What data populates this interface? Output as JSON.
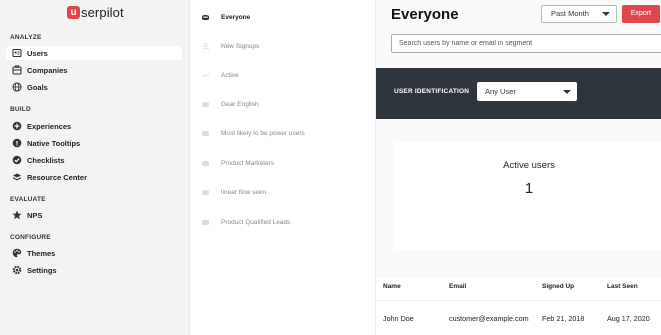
{
  "brand": {
    "logo_letter": "u",
    "logo_text": "serpilot",
    "accent": "#e0474c"
  },
  "sidebar": {
    "sections": {
      "analyze": "ANALYZE",
      "build": "BUILD",
      "evaluate": "EVALUATE",
      "configure": "CONFIGURE"
    },
    "items": [
      {
        "label": "Users",
        "icon": "users-icon"
      },
      {
        "label": "Companies",
        "icon": "companies-icon"
      },
      {
        "label": "Goals",
        "icon": "goals-icon"
      },
      {
        "label": "Experiences",
        "icon": "experiences-icon"
      },
      {
        "label": "Native Tooltips",
        "icon": "tooltips-icon"
      },
      {
        "label": "Checklists",
        "icon": "checklist-icon"
      },
      {
        "label": "Resource Center",
        "icon": "resource-center-icon"
      },
      {
        "label": "NPS",
        "icon": "star-icon"
      },
      {
        "label": "Themes",
        "icon": "themes-icon"
      },
      {
        "label": "Settings",
        "icon": "settings-icon"
      }
    ]
  },
  "segments": [
    {
      "label": "Everyone"
    },
    {
      "label": "New Signups"
    },
    {
      "label": "Active"
    },
    {
      "label": "Gear English"
    },
    {
      "label": "Most likely to be power users"
    },
    {
      "label": "Product Marketers"
    },
    {
      "label": "linear flow seen"
    },
    {
      "label": "Product Qualified Leads"
    }
  ],
  "main": {
    "title": "Everyone",
    "date_range": "Past Month",
    "export_label": "Export",
    "search_placeholder": "Search users by name or email in segment",
    "identification_label": "USER IDENTIFICATION",
    "user_filter": "Any User",
    "card": {
      "title": "Active users",
      "value": "1"
    },
    "table": {
      "headers": [
        "Name",
        "Email",
        "Signed Up",
        "Last Seen"
      ],
      "rows": [
        [
          "John Doe",
          "customer@example.com",
          "Feb 21, 2018",
          "Aug 17, 2020"
        ]
      ]
    }
  }
}
